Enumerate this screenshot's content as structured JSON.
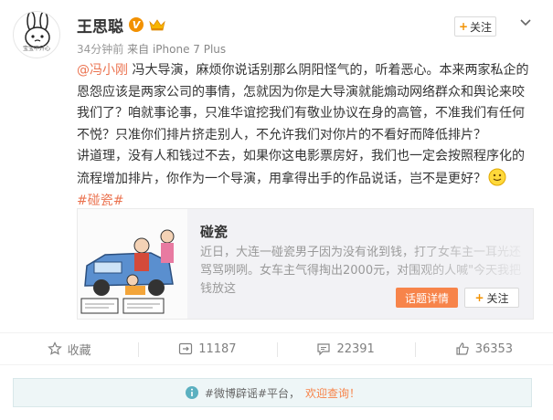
{
  "user": {
    "name": "王思聪",
    "verified_badge": "V",
    "avatar_caption": "宝宝不开心",
    "time": "34分钟前",
    "source_prefix": "来自",
    "source": "iPhone 7 Plus",
    "follow_label": "关注"
  },
  "post": {
    "mention": "@冯小刚",
    "lines": [
      " 冯大导演，麻烦你说话别那么阴阳怪气的，听着恶心。本来两家私企的",
      "恩怨应该是两家公司的事情，怎就因为你是大导演就能煽动网络群众和舆论来咬",
      "我们了？咱就事论事，只准华谊挖我们有敬业协议在身的高管，不准我们有任何",
      "不悦？只准你们排片挤走别人，不允许我们对你片的不看好而降低排片？",
      "讲道理，没有人和钱过不去，如果你这电影票房好，我们也一定会按照程序化的",
      "流程增加排片，你作为一个导演，用拿得出手的作品说话，岂不是更好？"
    ],
    "topic": "#碰瓷#",
    "emoji": "smile-emoji"
  },
  "share": {
    "title": "碰瓷",
    "desc": "近日，大连一碰瓷男子因为没有讹到钱，打了女车主一耳光还骂骂咧咧。女车主气得掏出2000元，对围观的人喊\"今天我把钱放这",
    "topic_button": "话题详情",
    "follow_label": "关注"
  },
  "actions": {
    "favorite": "收藏",
    "repost": "11187",
    "comment": "22391",
    "like": "36353"
  },
  "notice": {
    "text": "#微博辟谣#平台，",
    "link": "欢迎查询！"
  },
  "colors": {
    "accent": "#eb7350",
    "orange_button": "#f7844a",
    "vip": "#f29100"
  }
}
